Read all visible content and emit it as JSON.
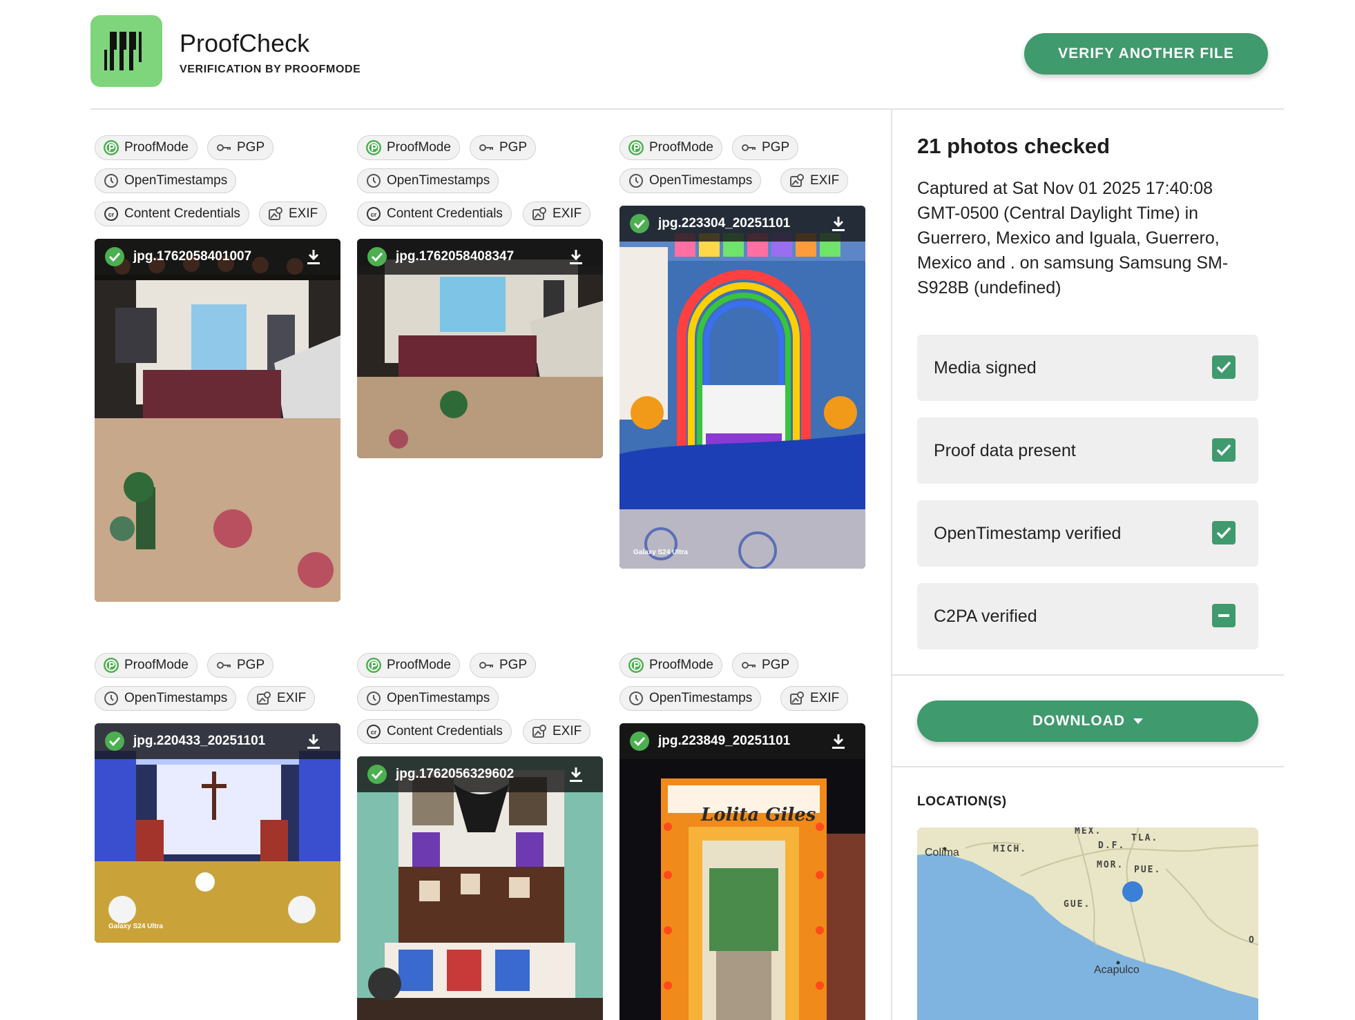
{
  "header": {
    "title": "ProofCheck",
    "subtitle": "VERIFICATION BY PROOFMODE",
    "verify_button": "VERIFY ANOTHER FILE"
  },
  "chip_labels": {
    "proofmode": "ProofMode",
    "pgp": "PGP",
    "opentimestamps": "OpenTimestamps",
    "content_credentials": "Content Credentials",
    "exif": "EXIF"
  },
  "cards": [
    {
      "filename": "jpg.1762058401007",
      "chips": [
        "proofmode",
        "pgp",
        "opentimestamps",
        "content_credentials",
        "exif"
      ]
    },
    {
      "filename": "jpg.1762058408347",
      "chips": [
        "proofmode",
        "pgp",
        "opentimestamps",
        "content_credentials",
        "exif"
      ]
    },
    {
      "filename": "jpg.223304_20251101",
      "chips": [
        "proofmode",
        "pgp",
        "opentimestamps",
        "exif"
      ],
      "watermark": "Galaxy S24 Ultra"
    },
    {
      "filename": "jpg.220433_20251101",
      "chips": [
        "proofmode",
        "pgp",
        "opentimestamps",
        "exif"
      ],
      "watermark": "Galaxy S24 Ultra"
    },
    {
      "filename": "jpg.1762056329602",
      "chips": [
        "proofmode",
        "pgp",
        "opentimestamps",
        "content_credentials",
        "exif"
      ]
    },
    {
      "filename": "jpg.223849_20251101",
      "chips": [
        "proofmode",
        "pgp",
        "opentimestamps",
        "exif"
      ],
      "sign": "Lolita Giles"
    }
  ],
  "summary": {
    "title": "21 photos checked",
    "text": "Captured at Sat Nov 01 2025 17:40:08 GMT-0500 (Central Daylight Time) in Guerrero, Mexico and Iguala, Guerrero, Mexico and . on samsung Samsung SM-S928B (undefined)"
  },
  "checks": [
    {
      "label": "Media signed",
      "state": "checked"
    },
    {
      "label": "Proof data present",
      "state": "checked"
    },
    {
      "label": "OpenTimestamp verified",
      "state": "checked"
    },
    {
      "label": "C2PA verified",
      "state": "indeterminate"
    }
  ],
  "download_button": "DOWNLOAD",
  "location": {
    "title": "LOCATION(S)",
    "labels": [
      "MEX.",
      "TLA.",
      "MICH.",
      "D.F.",
      "MOR.",
      "PUE.",
      "GUE.",
      "O"
    ],
    "cities": [
      "Colima",
      "Acapulco"
    ]
  },
  "colors": {
    "accent": "#3f9a6e",
    "logo_bg": "#7ed57c",
    "proofmode_icon": "#4caf50"
  }
}
